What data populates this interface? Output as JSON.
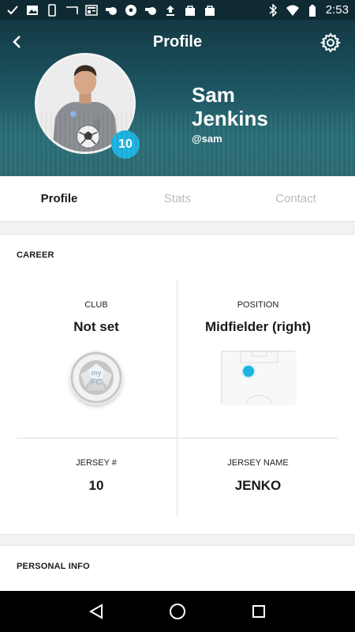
{
  "status_bar": {
    "time": "2:53",
    "left_icons": [
      "check-icon",
      "image-icon",
      "phone-icon",
      "tablet-icon",
      "news-icon",
      "whistle-icon",
      "soccer-ball-icon",
      "whistle-icon",
      "upload-icon",
      "bag-icon",
      "bag-icon"
    ],
    "right_icons": [
      "bluetooth-icon",
      "wifi-icon",
      "battery-icon"
    ]
  },
  "header": {
    "title": "Profile",
    "back_icon": "back-arrow-icon",
    "settings_icon": "gear-icon",
    "first_name": "Sam",
    "last_name": "Jenkins",
    "handle": "@sam",
    "jersey_badge": "10",
    "accent": "#1bb3e0"
  },
  "tabs": [
    {
      "label": "Profile",
      "active": true
    },
    {
      "label": "Stats",
      "active": false
    },
    {
      "label": "Contact",
      "active": false
    }
  ],
  "career": {
    "section_title": "CAREER",
    "club_label": "CLUB",
    "club_value": "Not set",
    "club_logo_text": [
      "my",
      "FC"
    ],
    "position_label": "POSITION",
    "position_value": "Midfielder (right)",
    "jersey_label": "JERSEY #",
    "jersey_value": "10",
    "jersey_name_label": "JERSEY NAME",
    "jersey_name_value": "JENKO"
  },
  "personal_info": {
    "section_title": "PERSONAL INFO"
  },
  "nav_bar": {
    "icons": [
      "nav-back-icon",
      "nav-home-icon",
      "nav-recents-icon"
    ]
  }
}
